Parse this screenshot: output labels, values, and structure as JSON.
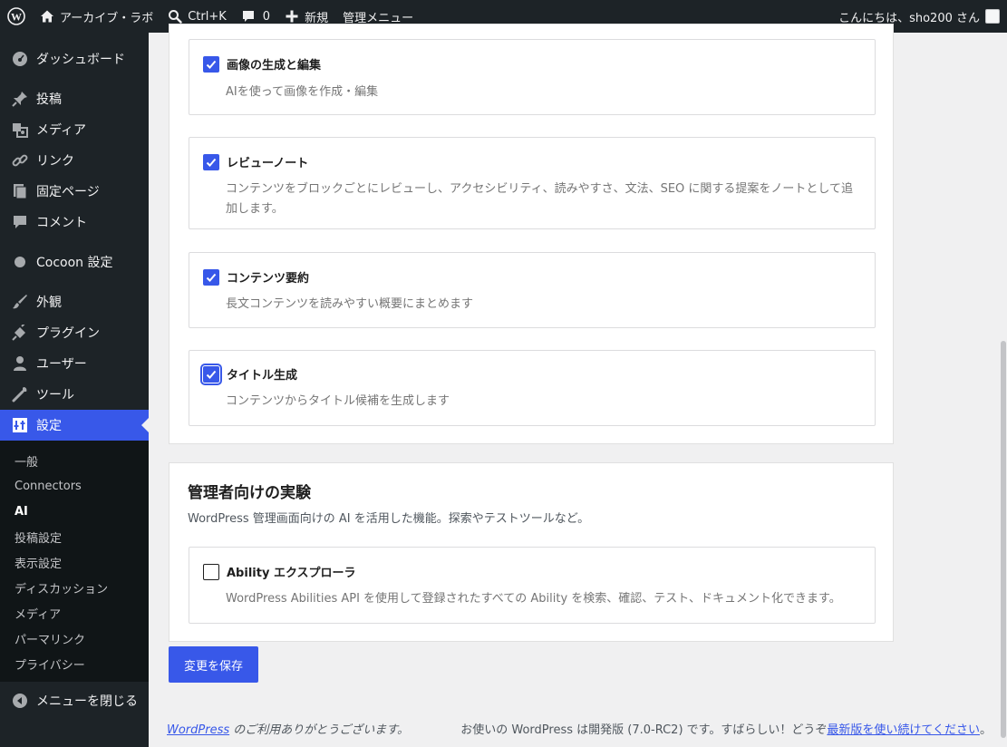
{
  "adminbar": {
    "site_name": "アーカイブ・ラボ",
    "search_shortcut": "Ctrl+K",
    "comments_count": "0",
    "new_label": "新規",
    "admin_menu_label": "管理メニュー",
    "greeting": "こんにちは、sho200 さん"
  },
  "sidebar": {
    "items": [
      {
        "label": "ダッシュボード",
        "icon": "dashboard-icon"
      },
      {
        "label": "投稿",
        "icon": "pin-icon"
      },
      {
        "label": "メディア",
        "icon": "media-icon"
      },
      {
        "label": "リンク",
        "icon": "link-icon"
      },
      {
        "label": "固定ページ",
        "icon": "page-icon"
      },
      {
        "label": "コメント",
        "icon": "comment-icon"
      },
      {
        "label": "Cocoon 設定",
        "icon": "circle-icon"
      },
      {
        "label": "外観",
        "icon": "brush-icon"
      },
      {
        "label": "プラグイン",
        "icon": "plugin-icon"
      },
      {
        "label": "ユーザー",
        "icon": "user-icon"
      },
      {
        "label": "ツール",
        "icon": "wrench-icon"
      },
      {
        "label": "設定",
        "icon": "settings-icon"
      }
    ],
    "submenu": [
      "一般",
      "Connectors",
      "AI",
      "投稿設定",
      "表示設定",
      "ディスカッション",
      "メディア",
      "パーマリンク",
      "プライバシー"
    ],
    "collapse_label": "メニューを閉じる"
  },
  "features": [
    {
      "title": "画像の生成と編集",
      "description": "AIを使って画像を作成・編集",
      "checked": true
    },
    {
      "title": "レビューノート",
      "description": "コンテンツをブロックごとにレビューし、アクセシビリティ、読みやすさ、文法、SEO に関する提案をノートとして追加します。",
      "checked": true
    },
    {
      "title": "コンテンツ要約",
      "description": "長文コンテンツを読みやすい概要にまとめます",
      "checked": true
    },
    {
      "title": "タイトル生成",
      "description": "コンテンツからタイトル候補を生成します",
      "checked": true
    }
  ],
  "admin_section": {
    "title": "管理者向けの実験",
    "description": "WordPress 管理画面向けの AI を活用した機能。探索やテストツールなど。",
    "experiments": [
      {
        "title": "Ability エクスプローラ",
        "description": "WordPress Abilities API を使用して登録されたすべての Ability を検索、確認、テスト、ドキュメント化できます。",
        "checked": false
      }
    ]
  },
  "save_button": "変更を保存",
  "footer": {
    "wordpress_link": "WordPress",
    "thanks": " のご利用ありがとうございます。",
    "version_text": "お使いの WordPress は開発版 (7.0-RC2) です。すばらしい！どうぞ",
    "continue_link": "最新版を使い続けてください",
    "period": "。"
  },
  "colors": {
    "accent": "#3858e9",
    "adminbar_bg": "#1d2327"
  }
}
